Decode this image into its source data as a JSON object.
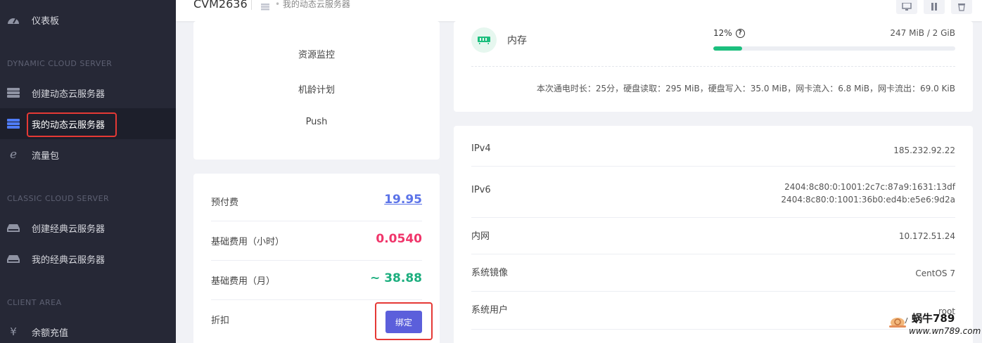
{
  "sidebar": {
    "items": [
      {
        "label": "仪表板",
        "icon": "dashboard-icon"
      },
      {
        "label": "创建动态云服务器",
        "icon": "server-icon"
      },
      {
        "label": "我的动态云服务器",
        "icon": "server-list-icon"
      },
      {
        "label": "流量包",
        "icon": "ie-icon"
      },
      {
        "label": "创建经典云服务器",
        "icon": "hdd-icon"
      },
      {
        "label": "我的经典云服务器",
        "icon": "hdd-icon"
      },
      {
        "label": "余额充值",
        "icon": "yen-icon"
      }
    ],
    "sections": [
      "DYNAMIC CLOUD SERVER",
      "CLASSIC CLOUD SERVER",
      "CLIENT AREA"
    ]
  },
  "header": {
    "title": "CVM2636",
    "breadcrumb": "我的动态云服务器"
  },
  "menu_links": [
    "资源监控",
    "机龄计划",
    "Push"
  ],
  "fees": {
    "prepaid_label": "预付费",
    "prepaid_value": "19.95",
    "hourly_label": "基础费用（小时）",
    "hourly_value": "0.0540",
    "monthly_label": "基础费用（月）",
    "monthly_value": "~ 38.88",
    "discount_label": "折扣",
    "bind_label": "绑定"
  },
  "memory": {
    "label": "内存",
    "percent_text": "12%",
    "percent": 12,
    "usage": "247 MiB / 2 GiB",
    "stats": "本次通电时长：25分，硬盘读取：295 MiB，硬盘写入：35.0 MiB，网卡流入：6.8 MiB，网卡流出：69.0 KiB"
  },
  "info": {
    "ipv4_label": "IPv4",
    "ipv4_value": "185.232.92.22",
    "ipv6_label": "IPv6",
    "ipv6_value_1": "2404:8c80:0:1001:2c7c:87a9:1631:13df",
    "ipv6_value_2": "2404:8c80:0:1001:36b0:ed4b:e5e6:9d2a",
    "intranet_label": "内网",
    "intranet_value": "10.172.51.24",
    "image_label": "系统镜像",
    "image_value": "CentOS 7",
    "user_label": "系统用户",
    "user_value": "root"
  },
  "watermark": {
    "line1": "蜗牛789",
    "line2": "www.wn789.com"
  },
  "colors": {
    "accent": "#5b5fdb",
    "prepaid": "#5b73e8",
    "hourly": "#f0356a",
    "monthly": "#1cae7e",
    "progress": "#1cbf7e",
    "highlight": "#e53935"
  }
}
